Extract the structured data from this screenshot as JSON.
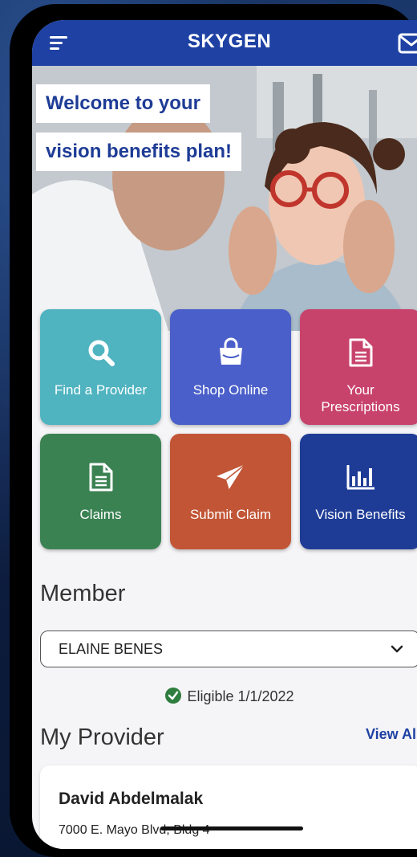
{
  "header": {
    "logo_text": "SKYGEN",
    "menu_icon": "hamburger-menu-icon",
    "mail_icon": "mail-icon",
    "bar_color": "#1e41a3"
  },
  "hero": {
    "welcome_line1": "Welcome to your",
    "welcome_line2": "vision benefits plan!",
    "title_color": "#1e3c96"
  },
  "tiles": [
    {
      "label": "Find a Provider",
      "icon": "search-icon",
      "color": "#4fb3c0"
    },
    {
      "label": "Shop Online",
      "icon": "shopping-bag-icon",
      "color": "#4a5fc9"
    },
    {
      "label": "Your Prescriptions",
      "icon": "document-icon",
      "color": "#c8436b"
    },
    {
      "label": "Claims",
      "icon": "document-icon",
      "color": "#3b8253"
    },
    {
      "label": "Submit Claim",
      "icon": "paper-plane-icon",
      "color": "#c15536"
    },
    {
      "label": "Vision Benefits",
      "icon": "bar-chart-icon",
      "color": "#1e3c96"
    }
  ],
  "member": {
    "title": "Member",
    "selected": "ELAINE BENES",
    "eligibility": "Eligible 1/1/2022"
  },
  "provider": {
    "title": "My Provider",
    "view_all": "View All",
    "name": "David Abdelmalak",
    "address": "7000 E. Mayo Blvd, Bldg 4"
  }
}
